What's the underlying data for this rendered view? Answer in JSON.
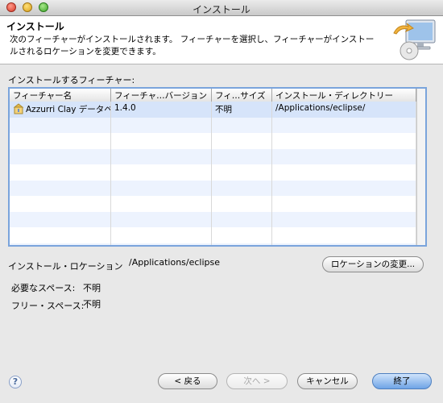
{
  "window": {
    "title": "インストール"
  },
  "header": {
    "title": "インストール",
    "description": "次のフィーチャーがインストールされます。 フィーチャーを選択し、フィーチャーがインストールされるロケーションを変更できます。"
  },
  "features": {
    "label": "インストールするフィーチャー:",
    "columns": [
      "フィーチャー名",
      "フィーチャ…バージョン",
      "フィ…サイズ",
      "インストール・ディレクトリー"
    ],
    "rows": [
      {
        "name": "Azzurri Clay データベ",
        "version": "1.4.0",
        "size": "不明",
        "directory": "/Applications/eclipse/",
        "icon": "feature-icon"
      }
    ]
  },
  "location": {
    "label": "インストール・ロケーション",
    "value": "/Applications/eclipse",
    "change_button": "ロケーションの変更..."
  },
  "space": {
    "required_label": "必要なスペース:",
    "required_value": "不明",
    "free_label": "フリー・スペース:",
    "free_value": "不明"
  },
  "buttons": {
    "back": "< 戻る",
    "next": "次へ >",
    "cancel": "キャンセル",
    "finish": "終了"
  },
  "colors": {
    "selection": "#d6e4fa",
    "focus_border": "#7aa4dc",
    "default_button": "#6fa4e6"
  }
}
